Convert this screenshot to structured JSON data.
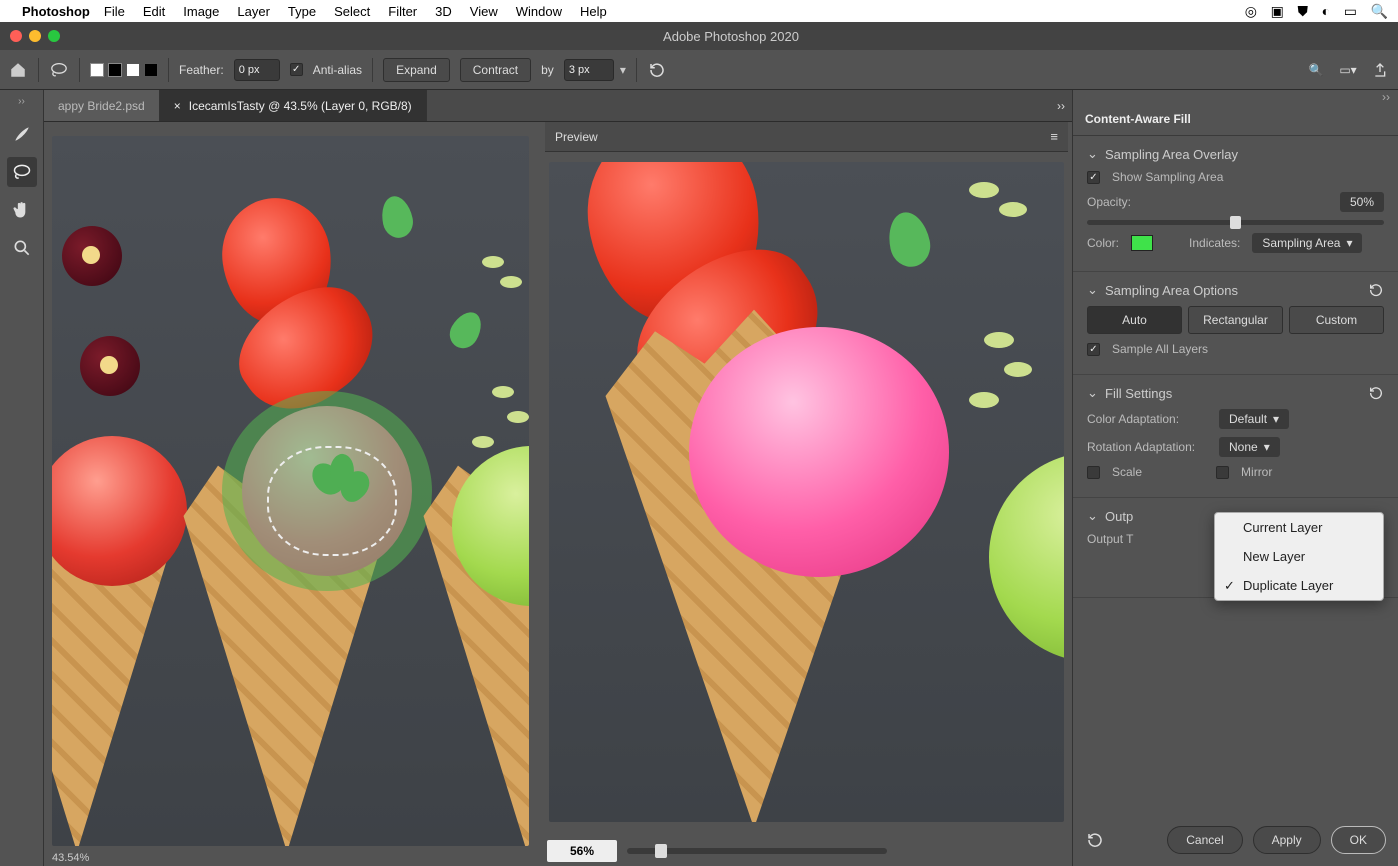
{
  "menubar": {
    "app": "Photoshop",
    "items": [
      "File",
      "Edit",
      "Image",
      "Layer",
      "Type",
      "Select",
      "Filter",
      "3D",
      "View",
      "Window",
      "Help"
    ]
  },
  "window_title": "Adobe Photoshop 2020",
  "options": {
    "feather_label": "Feather:",
    "feather": "0 px",
    "antialias": "Anti-alias",
    "expand": "Expand",
    "contract": "Contract",
    "by_label": "by",
    "by": "3 px"
  },
  "tabs": [
    {
      "label": "appy Bride2.psd",
      "active": false
    },
    {
      "label": "IcecamIsTasty @ 43.5% (Layer 0, RGB/8)",
      "active": true
    }
  ],
  "preview_label": "Preview",
  "zoom": {
    "left": "43.54%",
    "right": "56%"
  },
  "panel": {
    "title": "Content-Aware Fill",
    "sampling_overlay": "Sampling Area Overlay",
    "show_sampling": "Show Sampling Area",
    "opacity_label": "Opacity:",
    "opacity": "50%",
    "color_label": "Color:",
    "indicates_label": "Indicates:",
    "indicates": "Sampling Area",
    "sampling_options": "Sampling Area Options",
    "auto": "Auto",
    "rect": "Rectangular",
    "custom": "Custom",
    "sample_all": "Sample All Layers",
    "fill_settings": "Fill Settings",
    "color_adapt_label": "Color Adaptation:",
    "color_adapt": "Default",
    "rot_adapt_label": "Rotation Adaptation:",
    "rot_adapt": "None",
    "scale": "Scale",
    "mirror": "Mirror",
    "output_section": "Outp",
    "output_to": "Output T",
    "popup": [
      "Current Layer",
      "New Layer",
      "Duplicate Layer"
    ],
    "cancel": "Cancel",
    "apply": "Apply",
    "ok": "OK"
  }
}
